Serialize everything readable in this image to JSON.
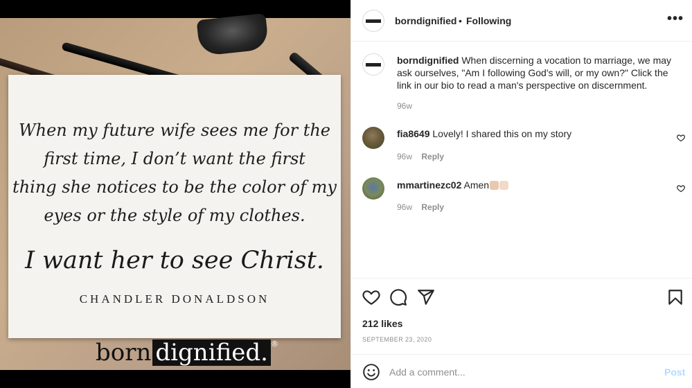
{
  "photo": {
    "quote_lines": [
      "When my future wife sees me for the",
      "first time, I don’t want the first",
      "thing she notices to be the color of my",
      "eyes or the style of my clothes."
    ],
    "quote_big": "I want her to see Christ.",
    "author": "CHANDLER DONALDSON",
    "brand_part1": "born",
    "brand_part2": "dignified.",
    "brand_reg": "®"
  },
  "header": {
    "username": "borndignified",
    "separator": "•",
    "follow_status": "Following",
    "more_icon": "more-horizontal-icon"
  },
  "caption": {
    "username": "borndignified",
    "text": " When discerning a vocation to marriage, we may ask ourselves, \"Am I following God's will, or my own?\" Click the link in our bio to read a man's perspective on discernment.",
    "time": "96w"
  },
  "comments": [
    {
      "username": "fia8649",
      "text": " Lovely! I shared this on my story",
      "time": "96w",
      "reply": "Reply"
    },
    {
      "username": "mmartinezc02",
      "text": " Amen",
      "time": "96w",
      "reply": "Reply",
      "emoji_colors": [
        "#e8c9b0",
        "#f3d9c8"
      ]
    }
  ],
  "actions": {
    "icons": [
      "heart-icon",
      "comment-icon",
      "share-icon",
      "bookmark-icon"
    ],
    "likes": "212 likes",
    "date": "SEPTEMBER 23, 2020"
  },
  "composer": {
    "placeholder": "Add a comment...",
    "post_label": "Post"
  },
  "colors": {
    "text": "#262626",
    "muted": "#8e8e8e",
    "border": "#efefef",
    "post_disabled": "#b3dbff"
  }
}
